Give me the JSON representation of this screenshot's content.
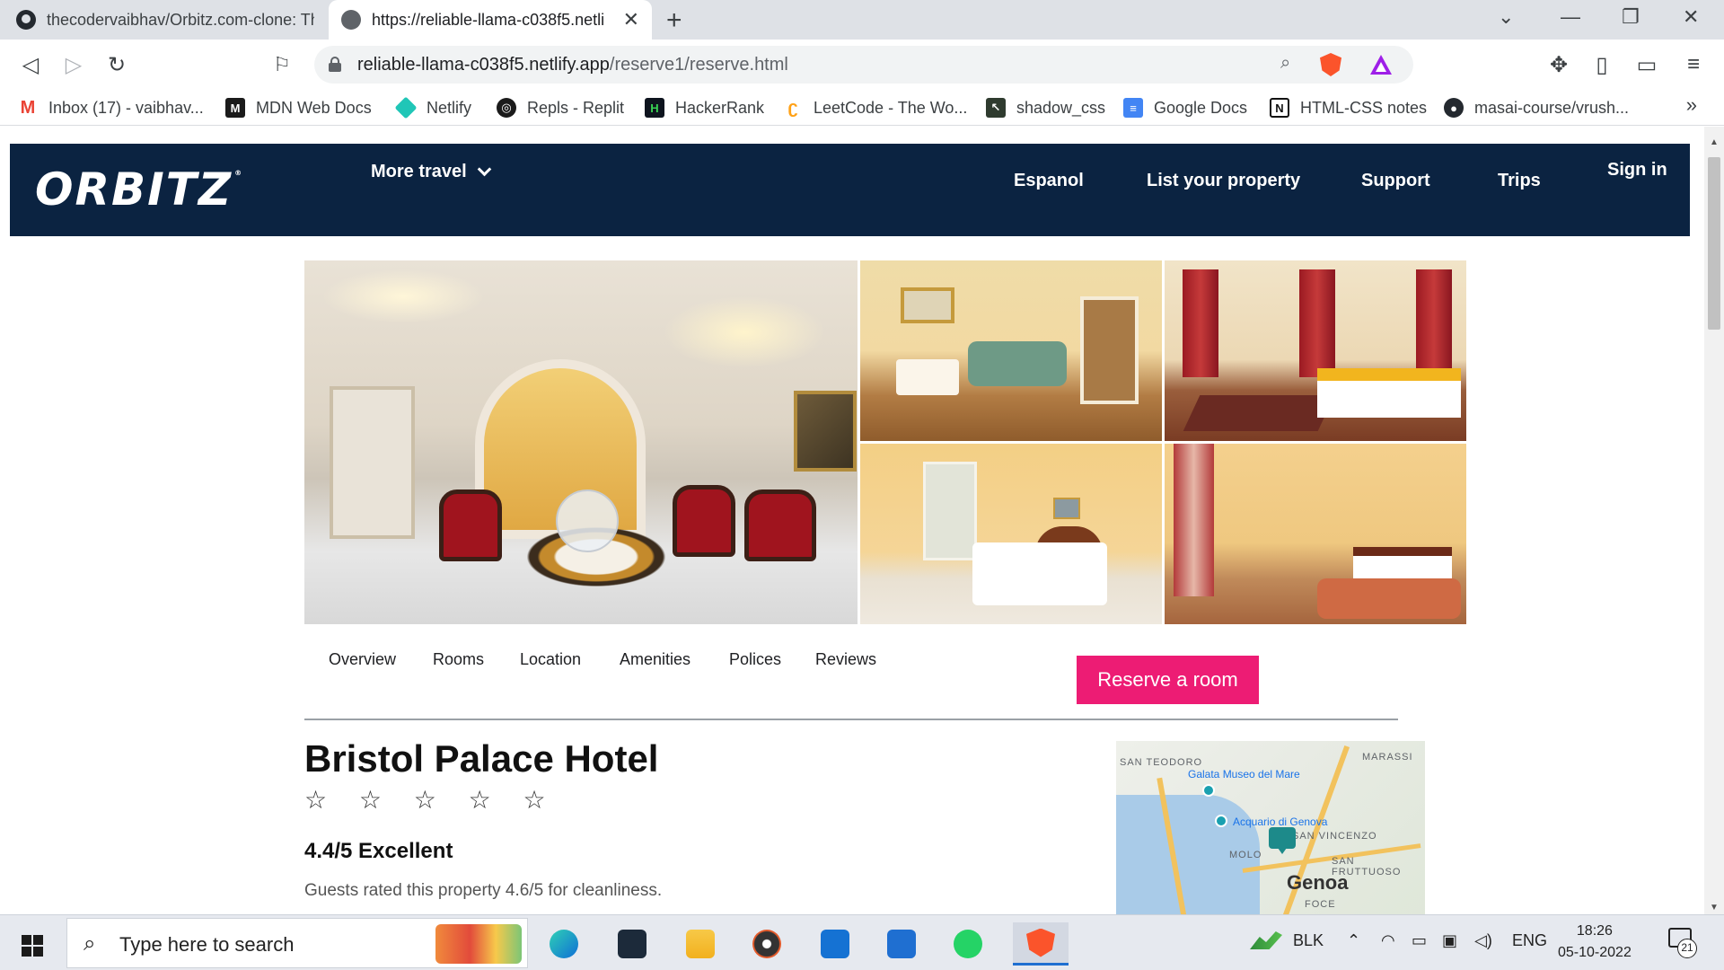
{
  "browser": {
    "tabs": [
      {
        "title": "thecodervaibhav/Orbitz.com-clone: Th",
        "active": false
      },
      {
        "title": "https://reliable-llama-c038f5.netli",
        "active": true
      }
    ],
    "new_tab_label": "+",
    "window_controls": {
      "minimize": "—",
      "restore": "❐",
      "close": "✕",
      "tab_search": "⌄"
    },
    "url_host": "reliable-llama-c038f5.netlify.app",
    "url_path": "/reserve1/reserve.html",
    "bookmarks": [
      {
        "label": "Inbox (17) - vaibhav...",
        "icon": "gmail-icon",
        "color": "#ea4335"
      },
      {
        "label": "MDN Web Docs",
        "icon": "mdn-icon",
        "color": "#1b1b1b"
      },
      {
        "label": "Netlify",
        "icon": "netlify-icon",
        "color": "#20c6b7"
      },
      {
        "label": "Repls - Replit",
        "icon": "replit-icon",
        "color": "#1b1b1b"
      },
      {
        "label": "HackerRank",
        "icon": "hackerrank-icon",
        "color": "#0e141e"
      },
      {
        "label": "LeetCode - The Wo...",
        "icon": "leetcode-icon",
        "color": "#ffa116"
      },
      {
        "label": "shadow_css",
        "icon": "shadow-css-icon",
        "color": "#2f3b2f"
      },
      {
        "label": "Google Docs",
        "icon": "google-docs-icon",
        "color": "#4285f4"
      },
      {
        "label": "HTML-CSS notes",
        "icon": "notion-icon",
        "color": "#111111"
      },
      {
        "label": "masai-course/vrush...",
        "icon": "github-icon",
        "color": "#24292f"
      }
    ],
    "bookmarks_overflow": "»"
  },
  "site": {
    "brand": "ORBITZ",
    "brand_color": "#0b2341",
    "nav": {
      "more_travel": "More travel",
      "links": [
        "Espanol",
        "List your property",
        "Support",
        "Trips"
      ],
      "sign_in": "Sign in"
    },
    "subnav": [
      "Overview",
      "Rooms",
      "Location",
      "Amenities",
      "Polices",
      "Reviews"
    ],
    "reserve_button": "Reserve a room",
    "reserve_color": "#ed1c74",
    "hotel": {
      "name": "Bristol Palace Hotel",
      "stars": "☆ ☆ ☆ ☆ ☆",
      "star_count": 5,
      "rating": "4.4/5 Excellent",
      "rating_sub": "Guests rated this property 4.6/5 for cleanliness."
    },
    "map": {
      "labels": {
        "san_teodoro": "SAN TEODORO",
        "marassi": "MARASSI",
        "galata": "Galata Museo del Mare",
        "acquario": "Acquario di Genova",
        "san_vincenzo": "SAN VINCENZO",
        "molo": "MOLO",
        "san_fruttuoso": "SAN FRUTTUOSO",
        "city": "Genoa",
        "foce": "FOCE"
      }
    }
  },
  "taskbar": {
    "search_placeholder": "Type here to search",
    "weather": "BLK",
    "language": "ENG",
    "time": "18:26",
    "date": "05-10-2022",
    "notifications": "21"
  }
}
